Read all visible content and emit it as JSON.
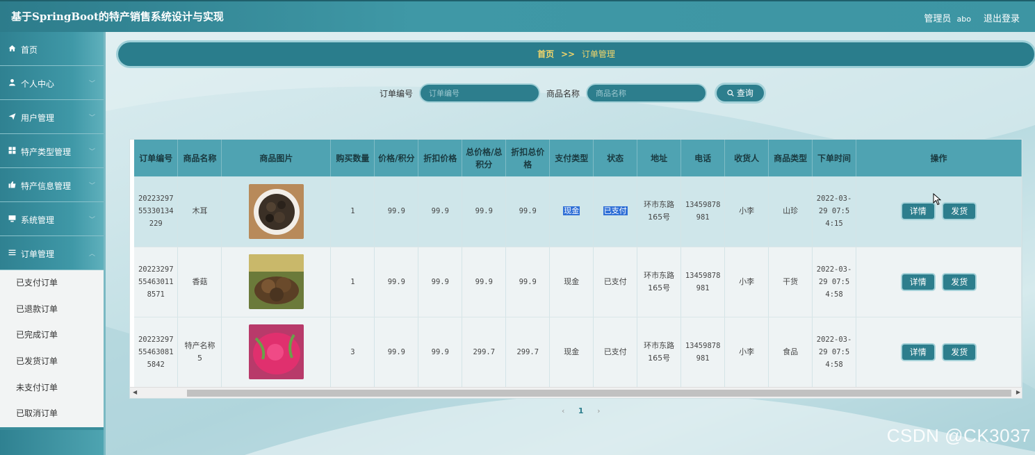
{
  "header": {
    "title": "基于SpringBoot的特产销售系统设计与实现",
    "user_role": "管理员",
    "user_name": "abo",
    "logout": "退出登录"
  },
  "sidebar": {
    "items": [
      {
        "label": "首页",
        "icon": "home-icon"
      },
      {
        "label": "个人中心",
        "icon": "user-icon"
      },
      {
        "label": "用户管理",
        "icon": "send-icon"
      },
      {
        "label": "特产类型管理",
        "icon": "grid-icon"
      },
      {
        "label": "特产信息管理",
        "icon": "thumb-icon"
      },
      {
        "label": "系统管理",
        "icon": "monitor-icon"
      },
      {
        "label": "订单管理",
        "icon": "list-icon"
      }
    ],
    "sub_items": [
      "已支付订单",
      "已退款订单",
      "已完成订单",
      "已发货订单",
      "未支付订单",
      "已取消订单"
    ]
  },
  "breadcrumb": {
    "home": "首页",
    "sep": ">>",
    "current": "订单管理"
  },
  "search": {
    "order_label": "订单编号",
    "order_placeholder": "订单编号",
    "product_label": "商品名称",
    "product_placeholder": "商品名称",
    "button": "查询"
  },
  "table": {
    "headers": [
      "订单编号",
      "商品名称",
      "商品图片",
      "购买数量",
      "价格/积分",
      "折扣价格",
      "总价格/总积分",
      "折扣总价格",
      "支付类型",
      "状态",
      "地址",
      "电话",
      "收货人",
      "商品类型",
      "下单时间",
      "操作"
    ],
    "rows": [
      {
        "order_no": "20223297553301 34229",
        "order_no_lines": [
          "20223297",
          "55330134",
          "229"
        ],
        "name": "木耳",
        "qty": "1",
        "price": "99.9",
        "discount_price": "99.9",
        "total": "99.9",
        "discount_total": "99.9",
        "pay_type": "现金",
        "status": "已支付",
        "address_lines": [
          "环市东路",
          "165号"
        ],
        "phone_lines": [
          "13459878",
          "981"
        ],
        "receiver": "小李",
        "category": "山珍",
        "time_lines": [
          "2022-03-",
          "29 07:5",
          "4:15"
        ]
      },
      {
        "order_no_lines": [
          "20223297",
          "55463011",
          "8571"
        ],
        "name": "香菇",
        "qty": "1",
        "price": "99.9",
        "discount_price": "99.9",
        "total": "99.9",
        "discount_total": "99.9",
        "pay_type": "现金",
        "status": "已支付",
        "address_lines": [
          "环市东路",
          "165号"
        ],
        "phone_lines": [
          "13459878",
          "981"
        ],
        "receiver": "小李",
        "category": "干货",
        "time_lines": [
          "2022-03-",
          "29 07:5",
          "4:58"
        ]
      },
      {
        "order_no_lines": [
          "20223297",
          "55463081",
          "5842"
        ],
        "name_lines": [
          "特产名称",
          "5"
        ],
        "qty": "3",
        "price": "99.9",
        "discount_price": "99.9",
        "total": "299.7",
        "discount_total": "299.7",
        "pay_type": "现金",
        "status": "已支付",
        "address_lines": [
          "环市东路",
          "165号"
        ],
        "phone_lines": [
          "13459878",
          "981"
        ],
        "receiver": "小李",
        "category": "食品",
        "time_lines": [
          "2022-03-",
          "29 07:5",
          "4:58"
        ]
      }
    ],
    "actions": {
      "detail": "详情",
      "ship": "发货"
    }
  },
  "pager": {
    "prev": "‹",
    "current": "1",
    "next": "›"
  },
  "watermark": "CSDN @CK3037",
  "colors": {
    "primary": "#2d7e8d",
    "header": "#4fa3b2",
    "accent_text": "#f3d66a",
    "selection": "#2f6fd6"
  }
}
